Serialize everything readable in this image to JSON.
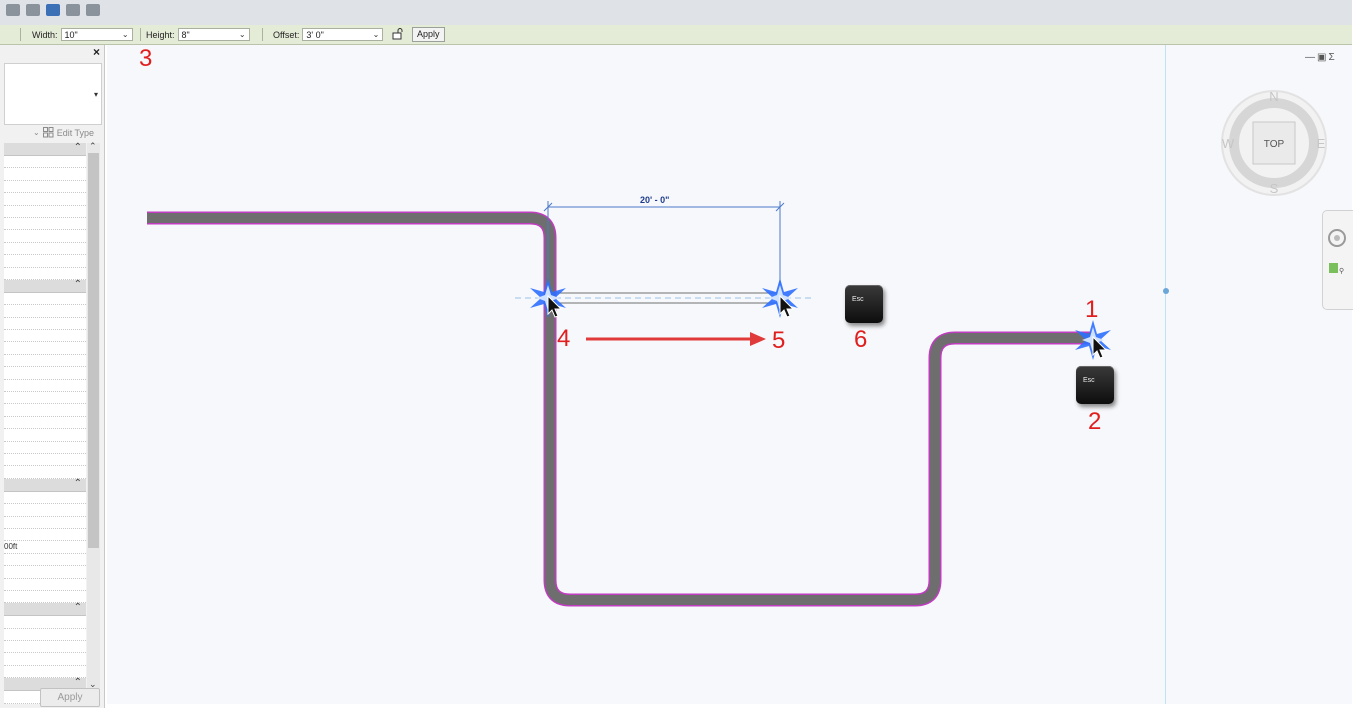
{
  "options_bar": {
    "width_label": "Width:",
    "width_value": "10\"",
    "height_label": "Height:",
    "height_value": "8\"",
    "offset_label": "Offset:",
    "offset_value": "3' 0\"",
    "apply_label": "Apply"
  },
  "properties": {
    "close_glyph": "×",
    "edit_type_label": "Edit Type",
    "partial_value": "00ft",
    "apply_label": "Apply"
  },
  "view_cube": {
    "top_label": "TOP",
    "north": "N",
    "south": "S",
    "east": "E",
    "west": "W"
  },
  "dimension": {
    "text": "20' - 0\""
  },
  "callouts": {
    "step1": "1",
    "step2": "2",
    "step3": "3",
    "step4": "4",
    "step5": "5",
    "step6": "6"
  },
  "keys": {
    "esc": "Esc"
  },
  "colors": {
    "options_bar_bg": "#e4ecd8",
    "duct_fill": "#6e6e6e",
    "duct_outline": "#c03cc0",
    "callout_red": "#e01e1e",
    "dimension_blue": "#1e3c8c",
    "highlight_blue": "#2d6fff"
  }
}
